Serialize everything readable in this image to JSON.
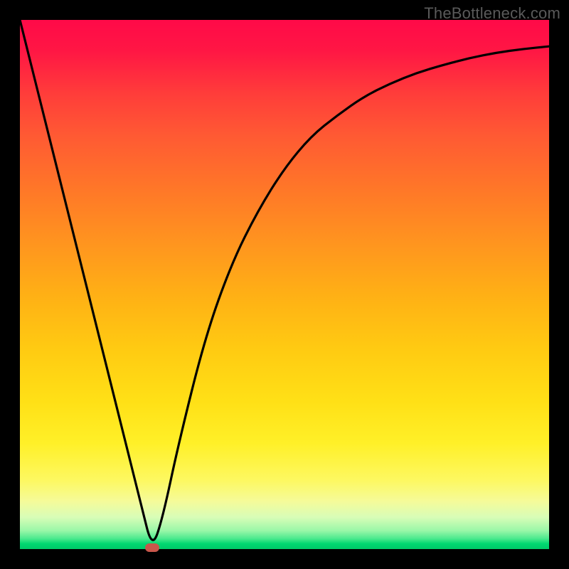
{
  "watermark": "TheBottleneck.com",
  "colors": {
    "frame": "#000000",
    "curve_stroke": "#000000",
    "marker_fill": "#c9574b",
    "gradient_top": "#ff0a48",
    "gradient_bottom": "#00c968"
  },
  "chart_data": {
    "type": "line",
    "title": "",
    "xlabel": "",
    "ylabel": "",
    "xlim": [
      0,
      100
    ],
    "ylim": [
      0,
      100
    ],
    "series": [
      {
        "name": "bottleneck-curve",
        "x": [
          0,
          5,
          10,
          15,
          20,
          23,
          25,
          27,
          30,
          35,
          40,
          45,
          50,
          55,
          60,
          65,
          70,
          75,
          80,
          85,
          90,
          95,
          100
        ],
        "y": [
          100,
          80,
          60,
          40,
          20,
          8,
          0,
          6,
          20,
          40,
          54,
          64,
          72,
          78,
          82,
          85.5,
          88,
          90,
          91.5,
          92.8,
          93.8,
          94.5,
          95
        ]
      }
    ],
    "annotations": [
      {
        "name": "min-marker",
        "x": 25,
        "y": 0,
        "shape": "rounded-rect",
        "color": "#c9574b"
      }
    ],
    "legend": false,
    "grid": false
  }
}
